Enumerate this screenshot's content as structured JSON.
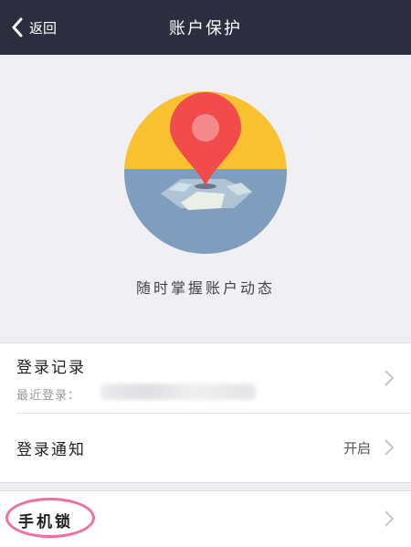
{
  "nav": {
    "back_label": "返回",
    "title": "账户保护"
  },
  "hero": {
    "caption": "随时掌握账户动态",
    "colors": {
      "sky": "#f9c02f",
      "sea": "#7f9dbd",
      "pin": "#f24b4b",
      "pin_highlight": "#f58a8a",
      "tile": "#e9efe6"
    }
  },
  "login_records": {
    "label": "登录记录",
    "sub_label": "最近登录："
  },
  "login_notify": {
    "label": "登录通知",
    "value": "开启"
  },
  "phone_lock": {
    "label": "手机锁"
  },
  "colors": {
    "nav_bg": "#2c2d3f",
    "page_bg": "#efeff4",
    "highlight_ring": "#f06fa0"
  }
}
